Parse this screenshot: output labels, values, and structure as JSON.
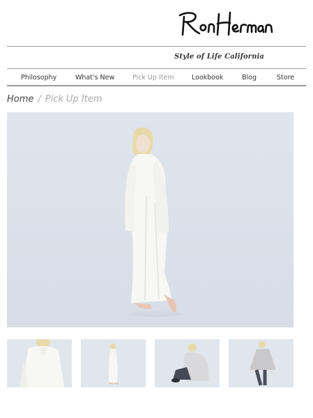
{
  "brand": {
    "logo_text": "Ron Herman",
    "tagline": "Style of Life California"
  },
  "nav": {
    "items": [
      {
        "label": "Philosophy"
      },
      {
        "label": "What's New"
      },
      {
        "label": "Pick Up Item",
        "active": true
      },
      {
        "label": "Lookbook"
      },
      {
        "label": "Blog"
      },
      {
        "label": "Store"
      }
    ]
  },
  "breadcrumb": {
    "home": "Home",
    "separator": "/",
    "current": "Pick Up Item"
  },
  "gallery": {
    "main_image": "model-white-knit-dress-photo",
    "thumbnails": [
      "sweater-closeup-photo",
      "full-length-white-dress-photo",
      "seated-model-grey-sweater-photo",
      "standing-model-grey-sweater-photo"
    ]
  },
  "colors": {
    "text": "#333333",
    "muted": "#aaaaaa",
    "rule": "#9a9a9a",
    "photo_background": "#dde3eb"
  }
}
